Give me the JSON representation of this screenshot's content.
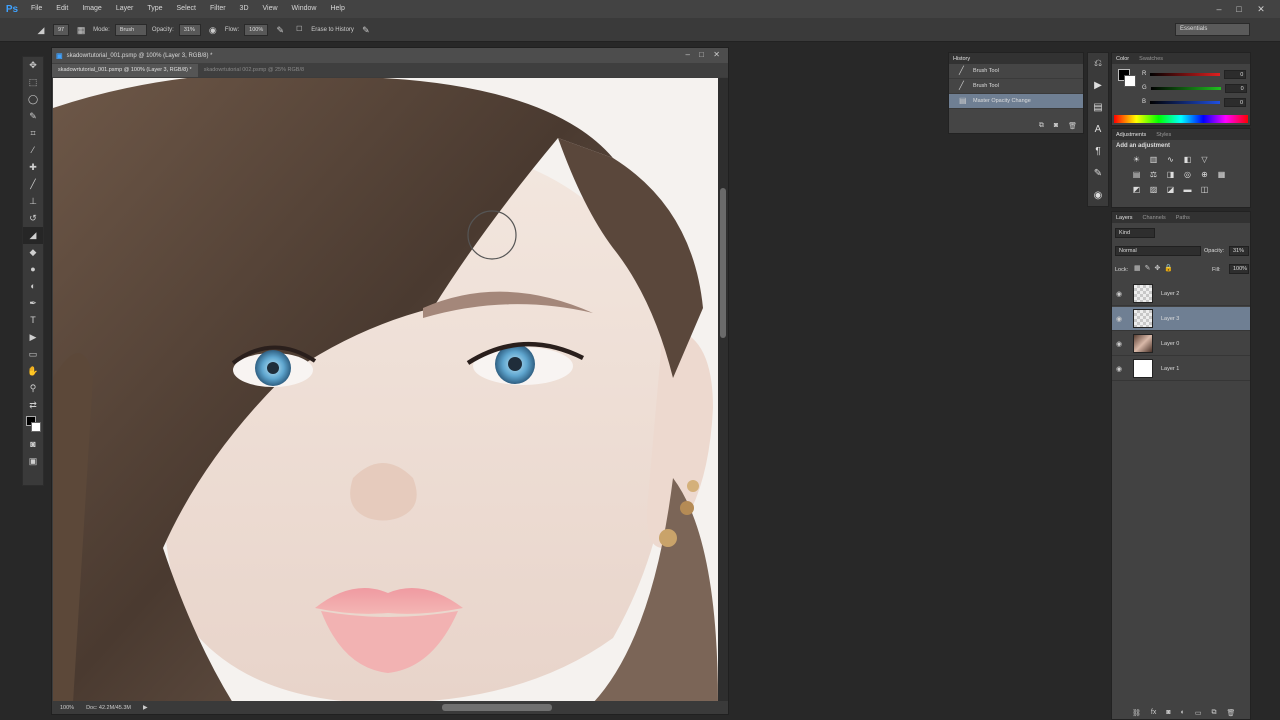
{
  "app": {
    "logo": "Ps"
  },
  "menu": [
    "File",
    "Edit",
    "Image",
    "Layer",
    "Type",
    "Select",
    "Filter",
    "3D",
    "View",
    "Window",
    "Help"
  ],
  "window_controls": {
    "minimize": "–",
    "maximize": "□",
    "close": "✕"
  },
  "options_bar": {
    "brush_size": "97",
    "mode_label": "Mode:",
    "mode_value": "Brush",
    "opacity_label": "Opacity:",
    "opacity_value": "31%",
    "flow_label": "Flow:",
    "flow_value": "100%",
    "erase_to_history_label": "Erase to History"
  },
  "workspace": "Essentials",
  "document": {
    "window_title": "skadowrtutorial_001.psmp @ 100% (Layer 3, RGB/8) *",
    "tabs": [
      {
        "label": "skadowrtutorial_001.psmp @ 100% (Layer 3, RGB/8) *",
        "active": true
      },
      {
        "label": "skadowrtutorial 002.psmp @ 25% RGB/8",
        "active": false
      }
    ],
    "zoom": "100%",
    "doc_info": "Doc: 42.2M/45.3M"
  },
  "history": {
    "title": "History",
    "items": [
      {
        "label": "Brush Tool",
        "selected": false
      },
      {
        "label": "Brush Tool",
        "selected": false
      },
      {
        "label": "Master Opacity Change",
        "selected": true
      }
    ]
  },
  "color_panel": {
    "tabs": [
      "Color",
      "Swatches"
    ],
    "channels": [
      {
        "label": "R",
        "value": "0",
        "color": "#e02020"
      },
      {
        "label": "G",
        "value": "0",
        "color": "#20c020"
      },
      {
        "label": "B",
        "value": "0",
        "color": "#2050e0"
      }
    ]
  },
  "adjustments_panel": {
    "tabs": [
      "Adjustments",
      "Styles"
    ],
    "heading": "Add an adjustment"
  },
  "layers_panel": {
    "tabs": [
      "Layers",
      "Channels",
      "Paths"
    ],
    "filter": "Kind",
    "blend_mode": "Normal",
    "opacity_label": "Opacity:",
    "opacity_value": "31%",
    "lock_label": "Lock:",
    "fill_label": "Fill:",
    "fill_value": "100%",
    "layers": [
      {
        "name": "Layer 2",
        "selected": false,
        "thumb": "checker"
      },
      {
        "name": "Layer 3",
        "selected": true,
        "thumb": "checker"
      },
      {
        "name": "Layer 0",
        "selected": false,
        "thumb": "photo"
      },
      {
        "name": "Layer 1",
        "selected": false,
        "thumb": "white"
      }
    ]
  }
}
